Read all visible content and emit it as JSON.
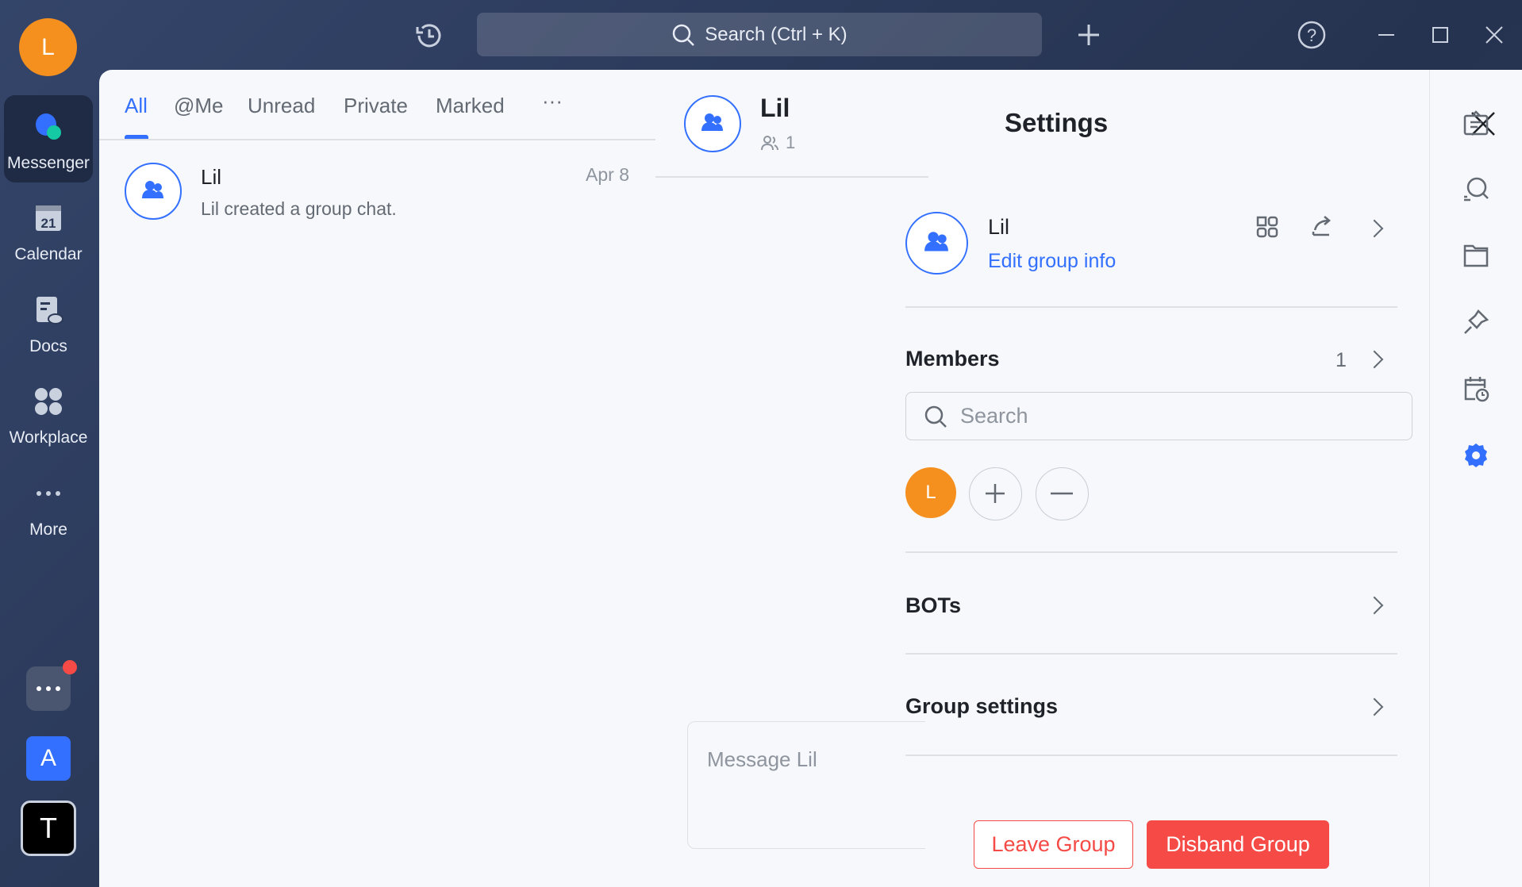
{
  "user_avatar_initial": "L",
  "nav": {
    "items": [
      {
        "label": "Messenger",
        "icon": "messenger-icon"
      },
      {
        "label": "Calendar",
        "icon": "calendar-icon",
        "day": "21"
      },
      {
        "label": "Docs",
        "icon": "docs-icon"
      },
      {
        "label": "Workplace",
        "icon": "workplace-icon"
      },
      {
        "label": "More",
        "icon": "more-icon"
      }
    ],
    "app_a": "A",
    "app_t": "T"
  },
  "topbar": {
    "search_placeholder": "Search (Ctrl + K)"
  },
  "tabs": [
    "All",
    "@Me",
    "Unread",
    "Private",
    "Marked",
    "···"
  ],
  "chats": [
    {
      "name": "Lil",
      "preview": "Lil created a group chat.",
      "date": "Apr 8"
    }
  ],
  "chat_header": {
    "title": "Lil",
    "member_count": "1"
  },
  "composer": {
    "placeholder": "Message Lil"
  },
  "settings": {
    "title": "Settings",
    "group_name": "Lil",
    "edit_link": "Edit group info",
    "members_label": "Members",
    "members_count": "1",
    "member_search_placeholder": "Search",
    "member_initial": "L",
    "bots_label": "BOTs",
    "group_settings_label": "Group settings",
    "leave_button": "Leave Group",
    "disband_button": "Disband Group"
  },
  "colors": {
    "accent": "#3370ff",
    "danger": "#f54a45",
    "avatar_orange": "#f5901f"
  }
}
